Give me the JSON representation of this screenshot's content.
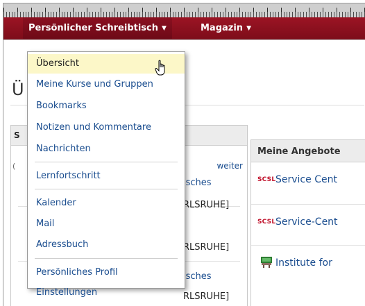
{
  "menubar": {
    "desktop_label": "Persönlicher Schreibtisch",
    "magazin_label": "Magazin"
  },
  "page": {
    "title_fragment": "Ü"
  },
  "left_panel": {
    "header_char": "S",
    "paren": "(",
    "more_link": "weiter",
    "fragments": [
      "isches",
      "RLSRUHE]",
      "RLSRUHE]",
      "isches",
      "RLSRUHE]"
    ]
  },
  "right_panel": {
    "title": "Meine Angebote",
    "offers": [
      {
        "badge": "SCSL",
        "label": "Service Cent"
      },
      {
        "badge": "SCSL",
        "label": "Service-Cent"
      },
      {
        "icon": "institute-icon",
        "label": "Institute for"
      }
    ]
  },
  "dropdown": {
    "groups": [
      [
        "Übersicht",
        "Meine Kurse und Gruppen",
        "Bookmarks",
        "Notizen und Kommentare",
        "Nachrichten"
      ],
      [
        "Lernfortschritt"
      ],
      [
        "Kalender",
        "Mail",
        "Adressbuch"
      ],
      [
        "Persönliches Profil",
        "Einstellungen"
      ]
    ],
    "active": "Übersicht"
  },
  "colors": {
    "menubar": "#8a1020",
    "link": "#1a4d8f",
    "active_item_bg": "#fcf7c8",
    "scsl_badge": "#c0102a"
  }
}
